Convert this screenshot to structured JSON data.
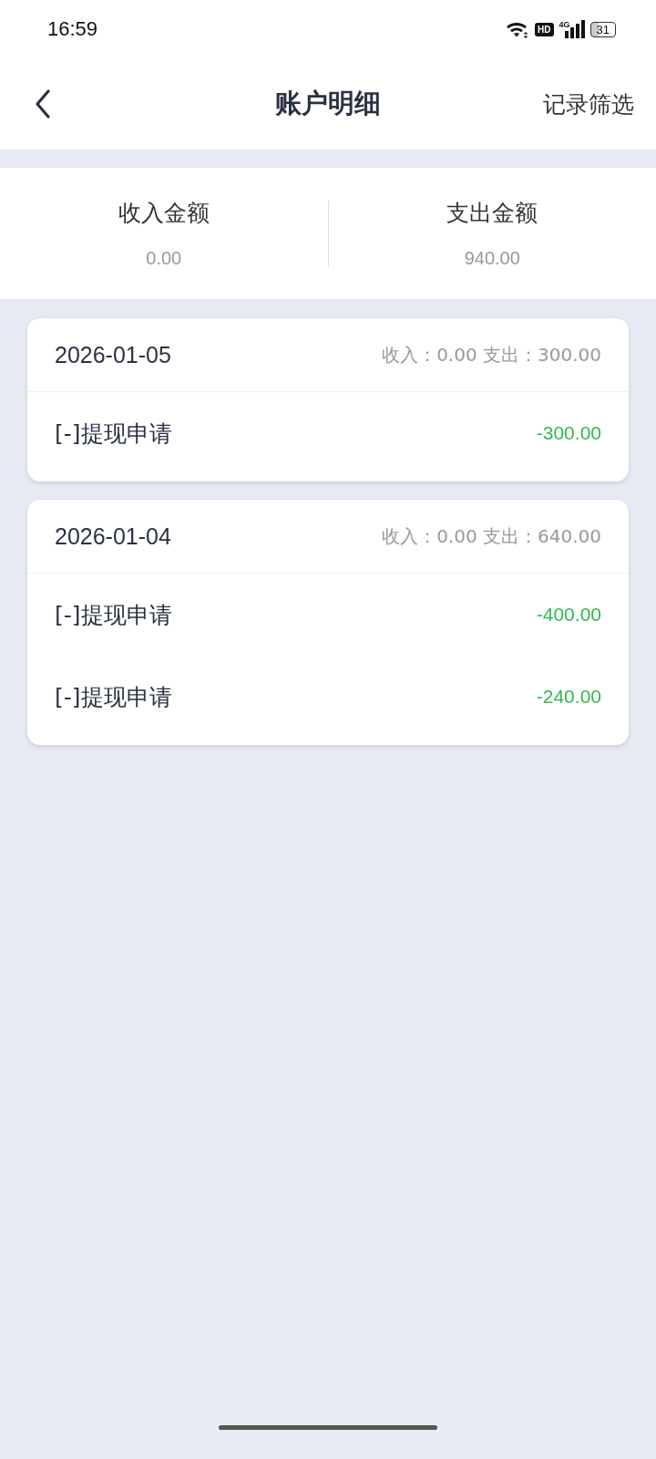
{
  "status_bar": {
    "time": "16:59",
    "hd": "HD",
    "network": "4G",
    "battery": "31"
  },
  "header": {
    "title": "账户明细",
    "action": "记录筛选"
  },
  "summary": [
    {
      "label": "收入金额",
      "value": "0.00"
    },
    {
      "label": "支出金额",
      "value": "940.00"
    }
  ],
  "days": [
    {
      "date": "2026-01-05",
      "totals": "收入：0.00 支出：300.00",
      "entries": [
        {
          "title": "[-]提现申请",
          "amount": "-300.00"
        }
      ]
    },
    {
      "date": "2026-01-04",
      "totals": "收入：0.00 支出：640.00",
      "entries": [
        {
          "title": "[-]提现申请",
          "amount": "-400.00"
        },
        {
          "title": "[-]提现申请",
          "amount": "-240.00"
        }
      ]
    }
  ]
}
